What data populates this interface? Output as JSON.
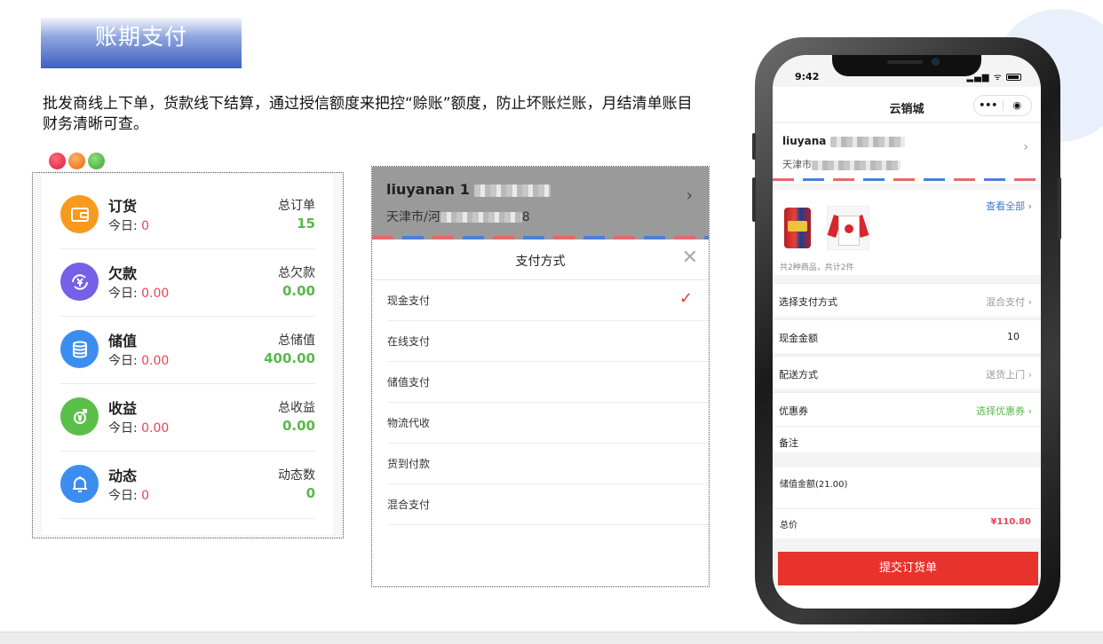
{
  "banner": {
    "title": "账期支付"
  },
  "description": "批发商线上下单，货款线下结算，通过授信额度来把控“赊账”额度，防止坏账烂账，月结清单账目财务清晰可查。",
  "stats": [
    {
      "name": "订货",
      "today_label": "今日: ",
      "today_value": "0",
      "total_label": "总订单",
      "total_value": "15",
      "icon": "wallet-icon",
      "color": "#f79a1e"
    },
    {
      "name": "欠款",
      "today_label": "今日: ",
      "today_value": "0.00",
      "total_label": "总欠款",
      "total_value": "0.00",
      "icon": "yuan-cycle-icon",
      "color": "#7560e8"
    },
    {
      "name": "储值",
      "today_label": "今日: ",
      "today_value": "0.00",
      "total_label": "总储值",
      "total_value": "400.00",
      "icon": "coins-stack-icon",
      "color": "#3c8df0"
    },
    {
      "name": "收益",
      "today_label": "今日: ",
      "today_value": "0.00",
      "total_label": "总收益",
      "total_value": "0.00",
      "icon": "yuan-collect-icon",
      "color": "#5bbf4a"
    },
    {
      "name": "动态",
      "today_label": "今日: ",
      "today_value": "0",
      "total_label": "动态数",
      "total_value": "0",
      "icon": "bell-icon",
      "color": "#3c8df0"
    }
  ],
  "payment_sheet": {
    "customer_name": "liuyanan 1",
    "customer_city": "天津市/河",
    "customer_suffix": "8",
    "title": "支付方式",
    "options": [
      "现金支付",
      "在线支付",
      "储值支付",
      "物流代收",
      "货到付款",
      "混合支付"
    ],
    "selected_check": "✓"
  },
  "phone": {
    "time": "9:42",
    "status_icons": "▂▄▆ ᯤ",
    "header_title": "云销城",
    "capsule_more": "•••",
    "capsule_target": "◉",
    "address_name": "liuyana",
    "address_city": "天津市",
    "view_all": "查看全部",
    "goods_count": "共2种商品，共计2件",
    "rows": [
      {
        "label": "选择支付方式",
        "value": "混合支付"
      },
      {
        "label": "现金金额",
        "value": "10"
      },
      {
        "label": "配送方式",
        "value": "送货上门"
      },
      {
        "label": "优惠券",
        "value": "选择优惠券"
      },
      {
        "label": "备注",
        "value": ""
      }
    ],
    "stored_amount": "储值金额(21.00)",
    "total_label": "总价",
    "total_value": "¥110.80",
    "submit_label": "提交订货单"
  },
  "colors": {
    "accent_red": "#e8322c",
    "value_red": "#e8445a",
    "value_green": "#59b94a",
    "link_blue": "#3a7bd5",
    "banner_blue": "#3d5fc0"
  }
}
